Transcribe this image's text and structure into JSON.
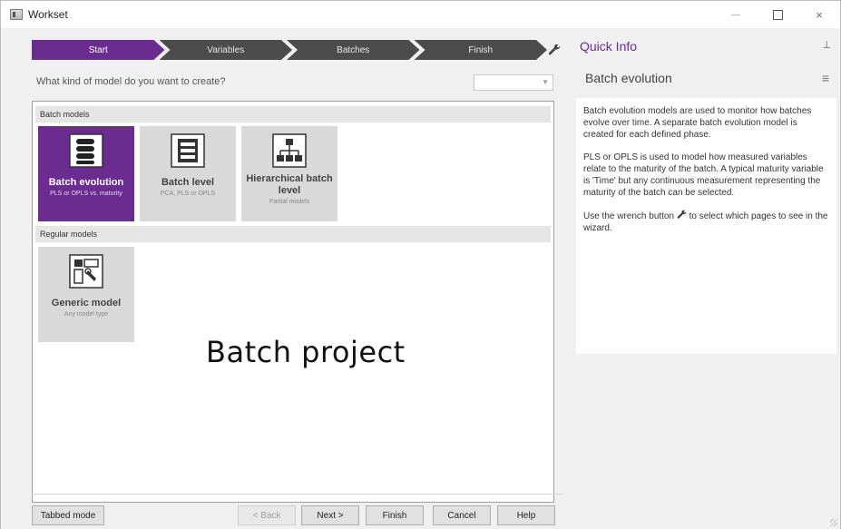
{
  "window": {
    "title": "Workset",
    "close_glyph": "×"
  },
  "wizard": {
    "steps": [
      "Start",
      "Variables",
      "Batches",
      "Finish"
    ],
    "question": "What kind of model do you want to create?",
    "select_value": "",
    "groups": [
      {
        "header": "Batch models",
        "tiles": [
          {
            "title": "Batch evolution",
            "subtitle": "PLS or OPLS vs. maturity",
            "icon": "batch-evolution-icon",
            "selected": true
          },
          {
            "title": "Batch level",
            "subtitle": "PCA, PLS or OPLS",
            "icon": "batch-level-icon",
            "selected": false
          },
          {
            "title": "Hierarchical batch level",
            "subtitle": "Partial models",
            "icon": "hierarchy-icon",
            "selected": false
          }
        ]
      },
      {
        "header": "Regular models",
        "tiles": [
          {
            "title": "Generic model",
            "subtitle": "Any model type",
            "icon": "generic-model-icon",
            "selected": false
          }
        ]
      }
    ],
    "overlay_label": "Batch project",
    "buttons": {
      "tabbed": "Tabbed mode",
      "back": "< Back",
      "next": "Next >",
      "finish": "Finish",
      "cancel": "Cancel",
      "help": "Help"
    }
  },
  "quick_info": {
    "title": "Quick Info",
    "pin_glyph": "⊥",
    "subtitle": "Batch evolution",
    "menu_glyph": "≡",
    "paragraphs": [
      "Batch evolution models are used to monitor how batches evolve over time. A separate batch evolution model is created for each defined phase.",
      "PLS or OPLS is used to model how measured variables relate to the maturity of the batch. A typical maturity variable is 'Time' but any continuous measurement representing the maturity of the batch can be selected."
    ],
    "wrench_text_before": "Use the wrench button",
    "wrench_text_after": "to select which pages to see in the wizard."
  },
  "colors": {
    "accent": "#6b2c91",
    "step_inactive": "#4c4c4c",
    "tile_bg": "#d9d9d9"
  }
}
